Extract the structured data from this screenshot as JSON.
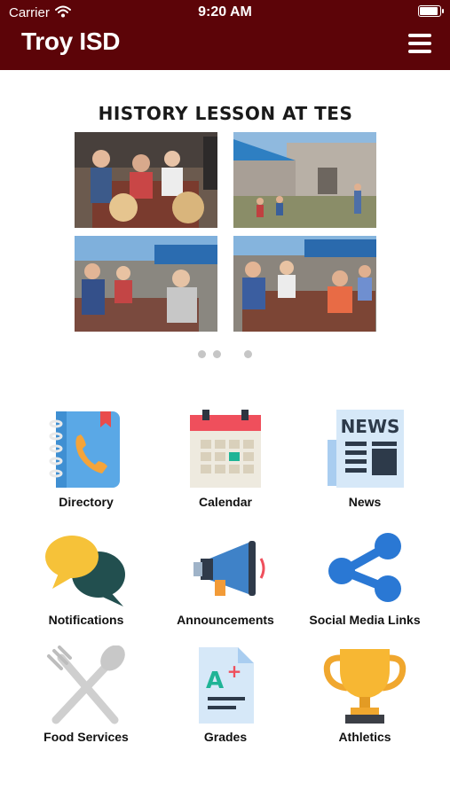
{
  "status_bar": {
    "carrier": "Carrier",
    "time": "9:20 AM",
    "battery_level": 1.0
  },
  "header": {
    "title": "Troy ISD",
    "menu_icon": "hamburger-menu-icon",
    "background_color": "#5c0408"
  },
  "slider": {
    "title": "HISTORY LESSON AT TES",
    "photos": [
      "students-at-picnic-table-photo",
      "students-outside-building-photo",
      "students-with-tools-at-table-photo",
      "students-at-bench-photo"
    ],
    "page_count": 3,
    "active_index": 2
  },
  "menu": [
    {
      "label": "Directory",
      "icon": "address-book-phone-icon"
    },
    {
      "label": "Calendar",
      "icon": "calendar-icon"
    },
    {
      "label": "News",
      "icon": "newspaper-icon"
    },
    {
      "label": "Notifications",
      "icon": "chat-bubbles-icon"
    },
    {
      "label": "Announcements",
      "icon": "megaphone-icon"
    },
    {
      "label": "Social Media Links",
      "icon": "share-icon"
    },
    {
      "label": "Food Services",
      "icon": "fork-spoon-icon"
    },
    {
      "label": "Grades",
      "icon": "grade-a-plus-icon"
    },
    {
      "label": "Athletics",
      "icon": "trophy-icon"
    }
  ],
  "colors": {
    "accent": "#5c0408",
    "dot_inactive": "#c6c6c6"
  }
}
